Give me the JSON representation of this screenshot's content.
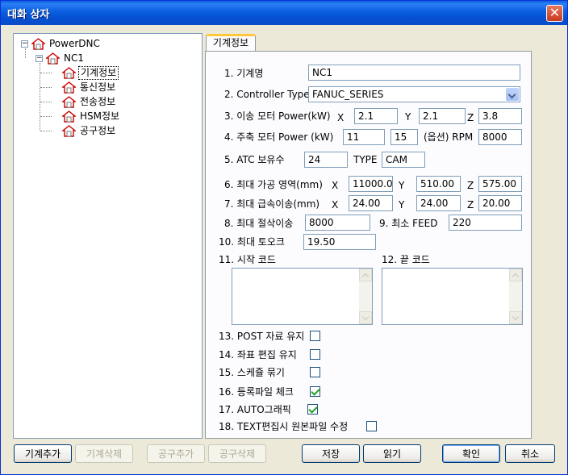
{
  "window": {
    "title": "대화 상자",
    "close_glyph": "✕"
  },
  "tree": {
    "root": "PowerDNC",
    "machine": "NC1",
    "items": [
      "기계정보",
      "통신정보",
      "전송정보",
      "HSM정보",
      "공구정보"
    ],
    "selected": "기계정보",
    "expander_glyph": "−"
  },
  "tab": {
    "label": "기계정보"
  },
  "form": {
    "f1": {
      "label": "1. 기계명",
      "value": "NC1"
    },
    "f2": {
      "label": "2. Controller Type",
      "value": "FANUC_SERIES"
    },
    "f3": {
      "label": "3. 이송 모터 Power(kW)",
      "x_label": "X",
      "x": "2.1",
      "y_label": "Y",
      "y": "2.1",
      "z_label": "Z",
      "z": "3.8"
    },
    "f4": {
      "label": "4. 주축 모터 Power (kW)",
      "v1": "11",
      "v2": "15",
      "option_label": "(옵션) RPM",
      "rpm": "8000"
    },
    "f5": {
      "label": "5. ATC 보유수",
      "value": "24",
      "type_label": "TYPE",
      "type": "CAM"
    },
    "f6": {
      "label": "6. 최대 가공 영역(mm)",
      "x_label": "X",
      "x": "11000.0",
      "y_label": "Y",
      "y": "510.00",
      "z_label": "Z",
      "z": "575.00"
    },
    "f7": {
      "label": "7. 최대 급속이송(mm)",
      "x_label": "X",
      "x": "24.00",
      "y_label": "Y",
      "y": "24.00",
      "z_label": "Z",
      "z": "20.00"
    },
    "f8": {
      "label": "8. 최대 절삭이송",
      "value": "8000"
    },
    "f9": {
      "label": "9. 최소 FEED",
      "value": "220"
    },
    "f10": {
      "label": "10. 최대 토오크",
      "value": "19.50"
    },
    "f11": {
      "label": "11. 시작 코드",
      "value": ""
    },
    "f12": {
      "label": "12. 끝 코드",
      "value": ""
    },
    "f13": {
      "label": "13. POST 자료 유지",
      "checked": false
    },
    "f14": {
      "label": "14. 좌표 편집 유지",
      "checked": false
    },
    "f15": {
      "label": "15. 스케쥴 묶기",
      "checked": false
    },
    "f16": {
      "label": "16. 등록파일 체크",
      "checked": true
    },
    "f17": {
      "label": "17. AUTO그래픽",
      "checked": true
    },
    "f18": {
      "label": "18. TEXT편집시 원본파일 수정",
      "checked": false
    }
  },
  "buttons": {
    "add_machine": "기계추가",
    "delete_machine": "기계삭제",
    "add_tool": "공구추가",
    "delete_tool": "공구삭제",
    "save": "저장",
    "read": "읽기",
    "ok": "확인",
    "cancel": "취소"
  }
}
